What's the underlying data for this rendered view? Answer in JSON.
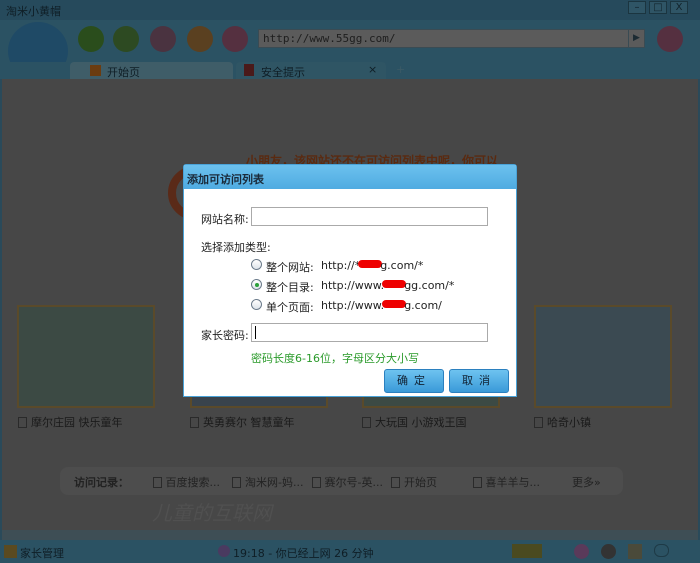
{
  "window": {
    "title": "淘米小黄帽",
    "min": "–",
    "max": "□",
    "close": "X"
  },
  "toolbar": {
    "url": "http://www.55gg.com/",
    "go": "▶"
  },
  "tabs": [
    {
      "label": "开始页"
    },
    {
      "label": "安全提示",
      "close": "×"
    }
  ],
  "new_tab": "+",
  "page": {
    "warning": "小朋友，该网站还不在可访问列表中呢，你可以",
    "sites": [
      {
        "label": "摩尔庄园 快乐童年"
      },
      {
        "label": "英勇赛尔 智慧童年"
      },
      {
        "label": "大玩国 小游戏王国"
      },
      {
        "label": "哈奇小镇"
      }
    ],
    "history": {
      "title": "访问记录：",
      "items": [
        "百度搜索...",
        "淘米网-妈...",
        "赛尔号-英...",
        "开始页",
        "喜羊羊与..."
      ],
      "more": "更多»"
    },
    "slogan": "儿童的互联网"
  },
  "dialog": {
    "title": "添加可访问列表",
    "site_name_label": "网站名称:",
    "site_name_value": "",
    "type_label": "选择添加类型:",
    "options": [
      {
        "label": "整个网站:",
        "url_prefix": "http://*",
        "url_suffix": "g.com/*",
        "selected": false
      },
      {
        "label": "整个目录:",
        "url_prefix": "http://www.",
        "url_suffix": "gg.com/*",
        "selected": true
      },
      {
        "label": "单个页面:",
        "url_prefix": "http://www.",
        "url_suffix": "g.com/",
        "selected": false
      }
    ],
    "password_label": "家长密码:",
    "password_value": "",
    "hint": "密码长度6-16位，字母区分大小写",
    "ok": "确定",
    "cancel": "取消",
    "hint_color": "#2a9a2a"
  },
  "status": {
    "parent": "家长管理",
    "time": "19:18 - 你已经上网 26 分钟"
  }
}
